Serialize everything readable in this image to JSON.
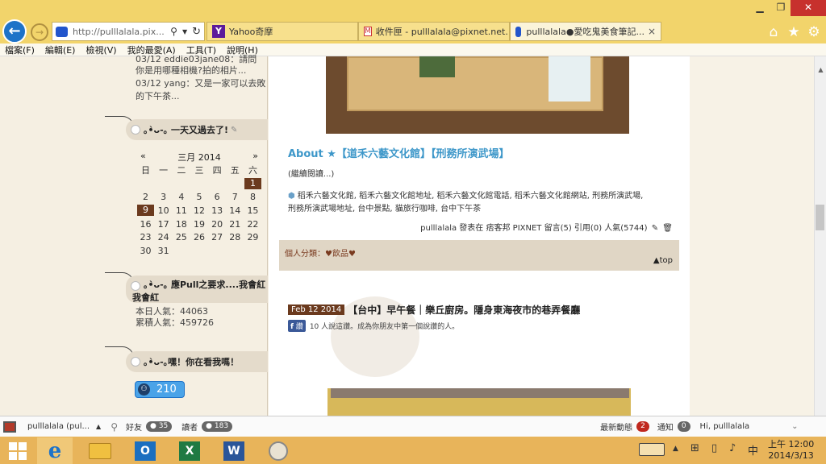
{
  "browser": {
    "url": "http://pulllalala.pix...",
    "tabs": [
      {
        "label": "Yahoo奇摩"
      },
      {
        "label": "收件匣 - pulllalala@pixnet.net..."
      },
      {
        "label": "pulllalala●愛吃鬼美食筆記..."
      }
    ],
    "tab_close": "×"
  },
  "menu": [
    "檔案(F)",
    "編輯(E)",
    "檢視(V)",
    "我的最愛(A)",
    "工具(T)",
    "說明(H)"
  ],
  "sidebar": {
    "comments": [
      "03/12 eddie03jane08：請問",
      "你是用哪種相機?拍的相片...",
      "03/12 yang：又是一家可以去敗",
      "的下午茶..."
    ],
    "widget_calendar_title": "｡•̀ᴗ-｡ 一天又過去了!",
    "calendar": {
      "prev": "«",
      "next": "»",
      "month": "三月 2014",
      "weekdays": [
        "日",
        "一",
        "二",
        "三",
        "四",
        "五",
        "六"
      ],
      "weeks": [
        [
          "",
          "",
          "",
          "",
          "",
          "",
          "1"
        ],
        [
          "2",
          "3",
          "4",
          "5",
          "6",
          "7",
          "8"
        ],
        [
          "9",
          "10",
          "11",
          "12",
          "13",
          "14",
          "15"
        ],
        [
          "16",
          "17",
          "18",
          "19",
          "20",
          "21",
          "22"
        ],
        [
          "23",
          "24",
          "25",
          "26",
          "27",
          "28",
          "29"
        ],
        [
          "30",
          "31",
          "",
          "",
          "",
          "",
          ""
        ]
      ]
    },
    "widget_counter_title": "｡•̀ᴗ-｡ 應Pull之要求....我會紅",
    "widget_counter_title2": "我會紅",
    "today_views": "本日人氣：44063",
    "total_views": "累積人氣：459726",
    "widget_watch_title": "｡•̀ᴗ-｡嘿！你在看我嗎！",
    "online_count": "210"
  },
  "post1": {
    "title": "About ★【道禾六藝文化館】【刑務所演武場】",
    "readmore": "(繼續閱讀...)",
    "tags_line1": "稻禾六藝文化館, 稻禾六藝文化館地址, 稻禾六藝文化館電話, 稻禾六藝文化館網站, 刑務所演武場,",
    "tags_line2": "刑務所演武場地址, 台中景點, 貓旅行咖啡, 台中下午茶",
    "meta": "pulllalala 發表在 痞客邦 PIXNET 留言(5) 引用(0) 人氣(5744)",
    "category": "個人分類：♥飲品♥",
    "top": "▲top"
  },
  "post2": {
    "date": "Feb 12 2014",
    "title": "【台中】早午餐｜樂丘廚房。隱身東海夜市的巷弄餐廳",
    "fb_label": "讚",
    "fb_text": "10 人說這讚。成為你朋友中第一個說讚的人。"
  },
  "statusbar": {
    "user_tab": "pulllalala (pul...",
    "friends_label": "好友",
    "friends_count": "35",
    "readers_label": "讀者",
    "readers_count": "183",
    "news_label": "最新動態",
    "news_count": "2",
    "notify_label": "通知",
    "notify_count": "0",
    "greeting": "Hi, pulllalala"
  },
  "taskbar": {
    "time": "上午 12:00",
    "date": "2014/3/13",
    "ime": "中"
  },
  "colors": {
    "titlebar": "#f2d46b",
    "accent_blue": "#3d97c9",
    "calendar_highlight": "#6b3a1e",
    "close_red": "#c7312d"
  }
}
